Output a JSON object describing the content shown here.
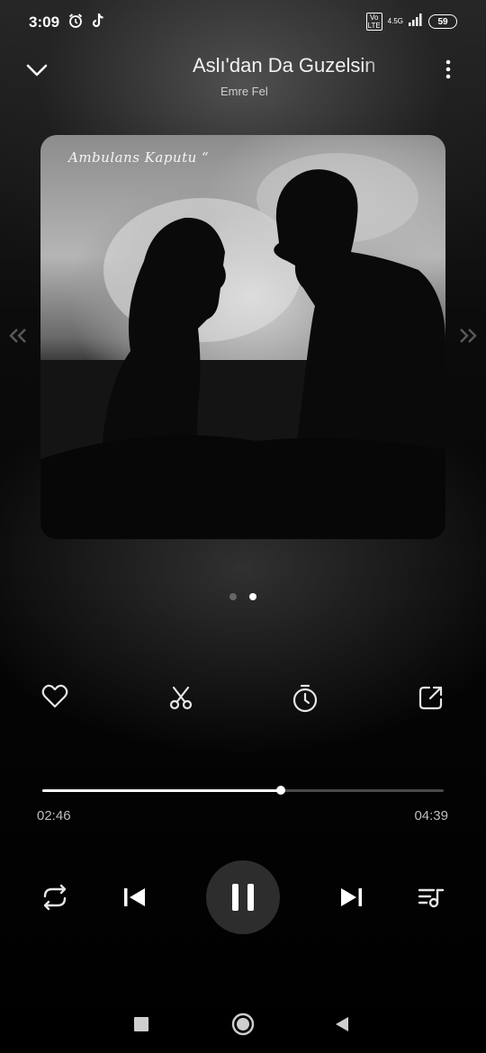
{
  "status_bar": {
    "time": "3:09",
    "network": "4.5G",
    "volte": "Vo LTE",
    "battery": "59"
  },
  "header": {
    "title": "Aslı'dan Da Guzelsin",
    "artist": "Emre Fel"
  },
  "artwork": {
    "caption": "Ambulans Kaputu “"
  },
  "pager": {
    "count": 2,
    "active_index": 1
  },
  "actions": [
    "heart-icon",
    "scissors-icon",
    "timer-icon",
    "share-icon"
  ],
  "progress": {
    "elapsed": "02:46",
    "total": "04:39",
    "fraction": 0.595
  },
  "controls": [
    "repeat-icon",
    "previous-icon",
    "pause-icon",
    "next-icon",
    "playlist-icon"
  ],
  "theme": {
    "accent": "#ffffff",
    "background": "#000000"
  }
}
